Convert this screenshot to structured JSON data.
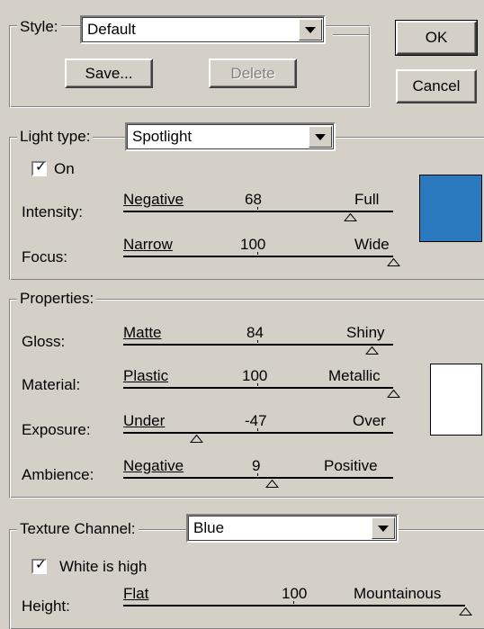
{
  "style": {
    "label": "Style:",
    "value": "Default",
    "save_label": "Save...",
    "delete_label": "Delete"
  },
  "buttons": {
    "ok_label": "OK",
    "cancel_label": "Cancel"
  },
  "light": {
    "type_label": "Light type:",
    "type_value": "Spotlight",
    "on_label": "On",
    "on_checked": true,
    "color": "#2b7ac0",
    "intensity": {
      "label": "Intensity:",
      "min_label": "Negative",
      "value": "68",
      "max_label": "Full",
      "position": 0.84
    },
    "focus": {
      "label": "Focus:",
      "min_label": "Narrow",
      "value": "100",
      "max_label": "Wide",
      "position": 1.0
    }
  },
  "properties": {
    "label": "Properties:",
    "color": "#ffffff",
    "gloss": {
      "label": "Gloss:",
      "min_label": "Matte",
      "value": "84",
      "max_label": "Shiny",
      "position": 0.92
    },
    "material": {
      "label": "Material:",
      "min_label": "Plastic",
      "value": "100",
      "max_label": "Metallic",
      "position": 1.0
    },
    "exposure": {
      "label": "Exposure:",
      "min_label": "Under",
      "value": "-47",
      "max_label": "Over",
      "position": 0.27
    },
    "ambience": {
      "label": "Ambience:",
      "min_label": "Negative",
      "value": "9",
      "max_label": "Positive",
      "position": 0.55
    }
  },
  "texture": {
    "label": "Texture Channel:",
    "value": "Blue",
    "white_is_high_label": "White is high",
    "white_is_high_checked": true,
    "height": {
      "label": "Height:",
      "min_label": "Flat",
      "value": "100",
      "max_label": "Mountainous",
      "position": 1.0
    }
  }
}
